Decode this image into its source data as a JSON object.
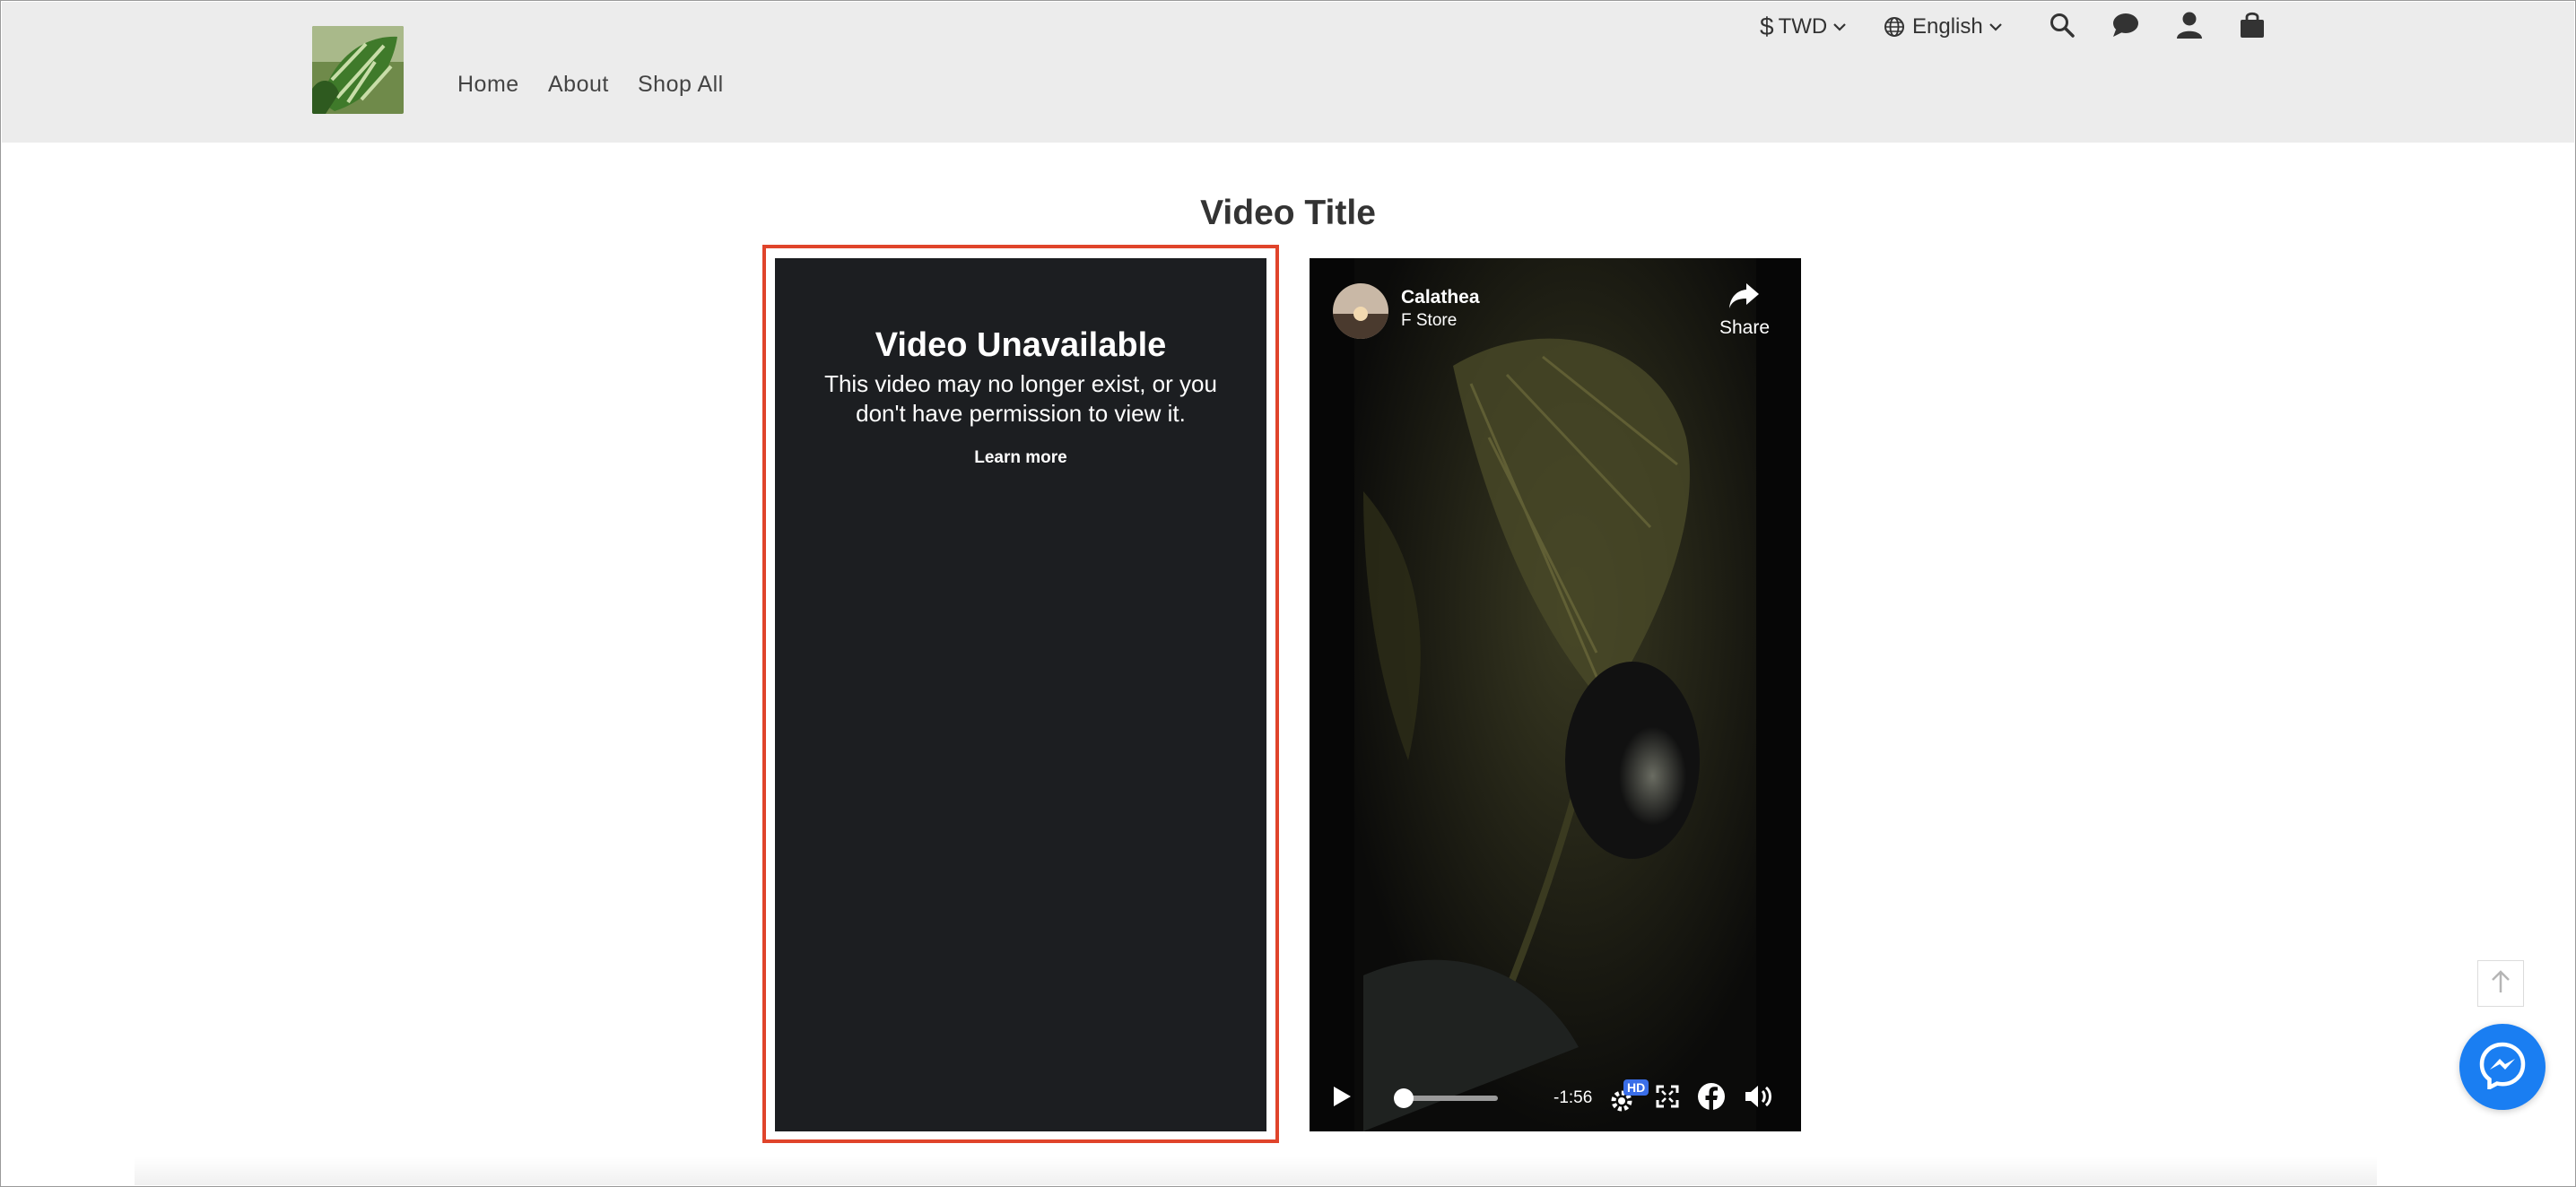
{
  "header": {
    "nav": [
      "Home",
      "About",
      "Shop All"
    ],
    "currency": "TWD",
    "currency_symbol": "$",
    "language": "English"
  },
  "page": {
    "title": "Video Title"
  },
  "left_video": {
    "heading": "Video Unavailable",
    "message": "This video may no longer exist, or you don't have permission to view it.",
    "learn_more": "Learn more"
  },
  "right_video": {
    "channel": "Calathea",
    "channel_sub": "F Store",
    "share_label": "Share",
    "time_remaining": "-1:56",
    "hd_badge": "HD",
    "progress": 0.0
  },
  "colors": {
    "header_bg": "#ececec",
    "highlight_border": "#e0442b",
    "messenger_blue": "#1a7ef2",
    "video_panel": "#1c1e21"
  },
  "icons": [
    "search-icon",
    "chat-icon",
    "user-icon",
    "shopping-bag-icon",
    "globe-icon",
    "chevron-down-icon",
    "share-icon",
    "play-icon",
    "settings-icon",
    "fullscreen-icon",
    "facebook-icon",
    "volume-icon",
    "arrow-up-icon",
    "messenger-icon"
  ]
}
